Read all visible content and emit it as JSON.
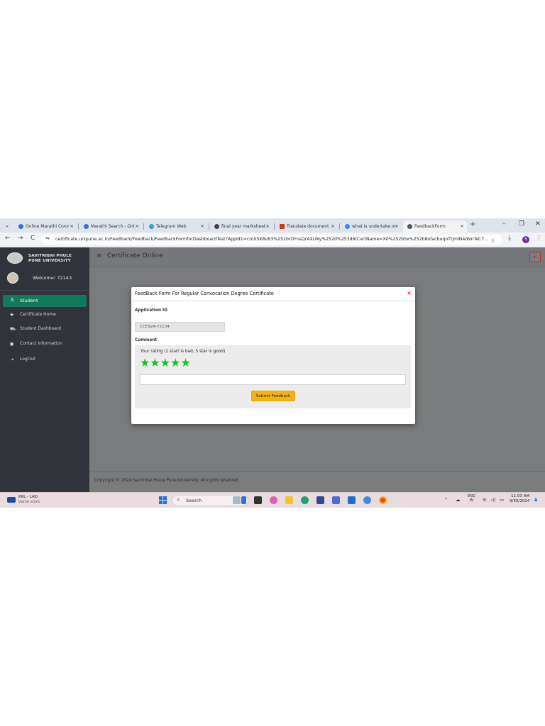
{
  "browser": {
    "tabs": [
      {
        "label": "Online Marathi Conv",
        "icon_color": "#3b6fd8",
        "active": false
      },
      {
        "label": "Marathi Search - Onl",
        "icon_color": "#3b6fd8",
        "active": false
      },
      {
        "label": "Telegram Web",
        "icon_color": "#2aa3e0",
        "active": false
      },
      {
        "label": "final year marksheet",
        "icon_color": "#444444",
        "active": false
      },
      {
        "label": "Translate document",
        "icon_color": "#d93025",
        "active": false
      },
      {
        "label": "what is undertake m",
        "icon_color": "#4285f4",
        "active": false
      },
      {
        "label": "FeedbackForm",
        "icon_color": "#555555",
        "active": true
      }
    ],
    "tab_close": "×",
    "new_tab": "+",
    "window_controls": {
      "minimize": "–",
      "restore": "❐",
      "close": "✕"
    },
    "nav": {
      "back": "←",
      "forward": "→",
      "reload": "C"
    },
    "url": "certificate.unipune.ac.in/Feedback/Feedback/FeedbackFormforDashboardTest?AppId1=cmXSK8vB3%252brOYnsQrAXLWy%252d%253d6tCertName=X0%252bSx%252b8ofacbuqoTtjmlN4/WnTeC7...",
    "profile_initial": "S"
  },
  "sidebar": {
    "brand_line1": "SAVITRIBAI PHULE",
    "brand_line2": "PUNE UNIVERSITY",
    "welcome": "Welcome! 72143",
    "active_item": {
      "icon": "♙",
      "label": "Student"
    },
    "items": [
      {
        "icon": "✚",
        "label": "Certificate Home"
      },
      {
        "icon": "⛟",
        "label": "Student Dashboard"
      },
      {
        "icon": "◼",
        "label": "Contact Information"
      },
      {
        "icon": "⇥",
        "label": "LogOut"
      }
    ]
  },
  "header": {
    "menu_icon": "≡",
    "title": "Certificate Online",
    "exit_icon": "⇤"
  },
  "modal": {
    "title": "FeedBack Form For Regular Convocation Degree Certificate",
    "close": "×",
    "application_id_label": "Application ID",
    "application_id_value": "CCE924-72134",
    "comment_label": "Comment",
    "rating_text": "Your rating (1 start is bad, 5 star is good)",
    "rating": 5,
    "rating_max": 5,
    "star_color": "#18c12a",
    "comment_value": "",
    "submit_label": "Submit Feedback"
  },
  "footer": {
    "copyright": "Copyright © 2024 Savitribai Phule Pune University. All rights reserved."
  },
  "taskbar": {
    "weather_line1": "KKL - LAD",
    "weather_line2": "Game score",
    "search_label": "Search",
    "lang_line1": "ENG",
    "lang_line2": "IN",
    "time": "11:03 AM",
    "date": "9/30/2024"
  }
}
